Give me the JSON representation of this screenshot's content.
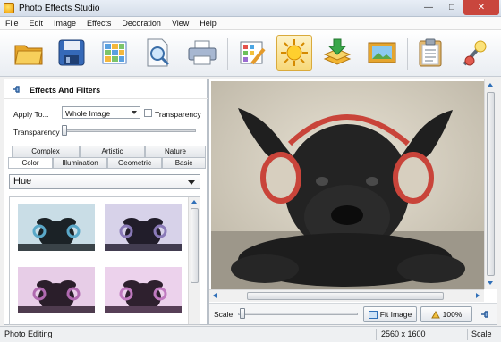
{
  "window": {
    "title": "Photo Effects Studio"
  },
  "menu": [
    "File",
    "Edit",
    "Image",
    "Effects",
    "Decoration",
    "View",
    "Help"
  ],
  "toolbar": {
    "buttons": [
      {
        "icon": "open-folder-icon"
      },
      {
        "icon": "save-disk-icon"
      },
      {
        "icon": "grid-icon"
      },
      {
        "icon": "preview-magnifier-icon"
      },
      {
        "icon": "printer-icon"
      },
      {
        "icon": "color-grid-pencil-icon"
      },
      {
        "icon": "sun-effects-icon",
        "active": true
      },
      {
        "icon": "layers-download-icon"
      },
      {
        "icon": "picture-frame-icon"
      },
      {
        "icon": "clipboard-icon"
      },
      {
        "icon": "magic-wand-icon"
      }
    ]
  },
  "panel": {
    "title": "Effects And Filters",
    "apply_to_label": "Apply To...",
    "apply_to_value": "Whole Image",
    "transparency_checkbox_label": "Transparency",
    "transparency_checked": false,
    "transparency_slider_label": "Transparency",
    "transparency_level": 0,
    "tabs_row1": [
      "Complex",
      "Artistic",
      "Nature"
    ],
    "tabs_row2": [
      "Color",
      "Illumination",
      "Geometric",
      "Basic"
    ],
    "active_tab": "Color",
    "effect_select": "Hue",
    "thumbnails": [
      {
        "tint": "#5aa8c8"
      },
      {
        "tint": "#8a7ab8"
      },
      {
        "tint": "#b06ab0"
      },
      {
        "tint": "#c07ac0"
      }
    ]
  },
  "viewer": {
    "scale_label": "Scale",
    "fit_button": "Fit Image",
    "zoom_button": "100%",
    "scale_level": 0
  },
  "status": {
    "left": "Photo Editing",
    "dimensions": "2560 x 1600",
    "right": "Scale"
  }
}
